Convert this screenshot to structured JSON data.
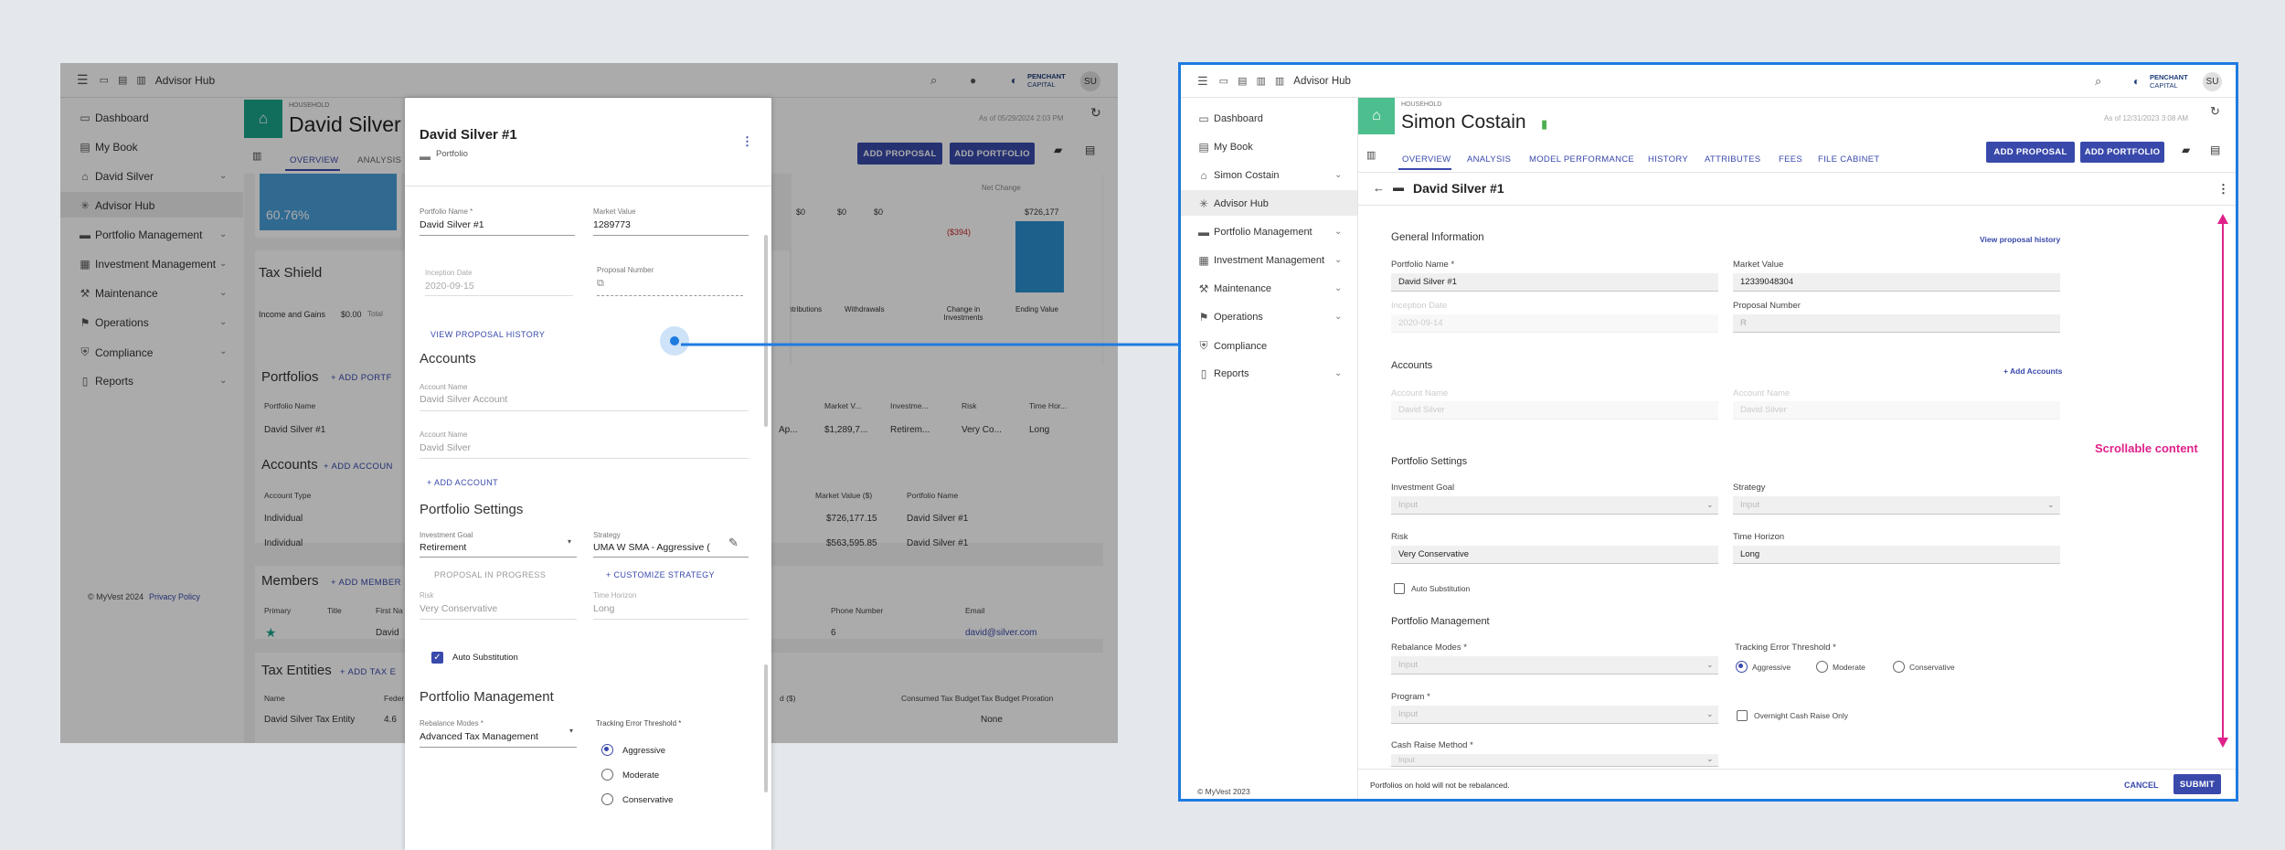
{
  "left": {
    "app_name": "Advisor Hub",
    "brand": {
      "name": "PENCHANT",
      "sub": "CAPITAL"
    },
    "avatar": "SU",
    "sidebar": [
      "Dashboard",
      "My Book",
      "David Silver",
      "Advisor Hub",
      "Portfolio Management",
      "Investment Management",
      "Maintenance",
      "Operations",
      "Compliance",
      "Reports"
    ],
    "footer": {
      "copyright": "© MyVest 2024",
      "privacy": "Privacy Policy"
    },
    "household": {
      "label": "HOUSEHOLD",
      "name": "David Silver",
      "as_of": "As of 05/29/2024 2:03 PM"
    },
    "tabs": [
      "OVERVIEW",
      "ANALYSIS"
    ],
    "buttons": {
      "add_proposal": "ADD PROPOSAL",
      "add_portfolio": "ADD PORTFOLIO"
    },
    "stat_pct": "60.76%",
    "chart": {
      "values": [
        "$0",
        "$0",
        "$0",
        "($394)",
        "$726,177"
      ],
      "xlabels": [
        "Contributions",
        "Withdrawals",
        "Change in Investments",
        "Ending Value"
      ],
      "net_change": "Net Change",
      "partial": [
        "",
        "..."
      ]
    },
    "tax_shield": {
      "title": "Tax Shield",
      "income": "Income and Gains",
      "amount": "$0.00",
      "total": "Total"
    },
    "portfolios": {
      "title": "Portfolios",
      "add": "+ ADD PORTF",
      "head": [
        "Portfolio Name",
        "Market V...",
        "Investme...",
        "Risk",
        "Time Hor..."
      ],
      "row": [
        "David Silver #1",
        "Ap...",
        "$1,289,7...",
        "Retirem...",
        "Very Co...",
        "Long"
      ]
    },
    "accounts": {
      "title": "Accounts",
      "add": "+ ADD ACCOUN",
      "head": [
        "Account Type",
        "Market Value ($)",
        "Portfolio Name"
      ],
      "rows": [
        [
          "Individual",
          "$726,177.15",
          "David Silver #1"
        ],
        [
          "Individual",
          "$563,595.85",
          "David Silver #1"
        ]
      ]
    },
    "members": {
      "title": "Members",
      "add": "+ ADD MEMBER",
      "head": [
        "Primary",
        "Title",
        "First Na",
        "Phone Number",
        "Email"
      ],
      "row": [
        "David",
        "6",
        "david@silver.com"
      ]
    },
    "tax_entities": {
      "title": "Tax Entities",
      "add": "+ ADD TAX E",
      "head": [
        "Name",
        "Feder",
        "d ($)",
        "Consumed Tax Budget",
        "Tax Budget Proration"
      ],
      "row": [
        "David Silver Tax Entity",
        "4.6",
        "None"
      ]
    }
  },
  "panel": {
    "title": "David Silver #1",
    "subtitle": "Portfolio",
    "portfolio_name_label": "Portfolio Name *",
    "portfolio_name": "David Silver #1",
    "market_value_label": "Market Value",
    "market_value": "1289773",
    "inception_label": "Inception Date",
    "inception": "2020-09-15",
    "proposal_label": "Proposal Number",
    "view_history": "VIEW PROPOSAL HISTORY",
    "accounts_title": "Accounts",
    "acct1_label": "Account Name",
    "acct1": "David Silver Account",
    "acct2_label": "Account Name",
    "acct2": "David Silver",
    "add_account": "+ ADD ACCOUNT",
    "settings_title": "Portfolio Settings",
    "goal_label": "Investment Goal",
    "goal": "Retirement",
    "strategy_label": "Strategy",
    "strategy": "UMA W SMA - Aggressive (",
    "in_progress": "PROPOSAL IN PROGRESS",
    "customize": "+ CUSTOMIZE STRATEGY",
    "risk_label": "Risk",
    "risk": "Very Conservative",
    "horizon_label": "Time Horizon",
    "horizon": "Long",
    "auto_sub": "Auto Substitution",
    "mgmt_title": "Portfolio Management",
    "rebalance_label": "Rebalance Modes *",
    "rebalance": "Advanced Tax Management",
    "tracking_label": "Tracking Error Threshold *",
    "tracking_options": [
      "Aggressive",
      "Moderate",
      "Conservative"
    ]
  },
  "right": {
    "app_name": "Advisor Hub",
    "brand": {
      "name": "PENCHANT",
      "sub": "CAPITAL"
    },
    "avatar": "SU",
    "sidebar": [
      "Dashboard",
      "My Book",
      "Simon Costain",
      "Advisor Hub",
      "Portfolio Management",
      "Investment Management",
      "Maintenance",
      "Operations",
      "Compliance",
      "Reports"
    ],
    "footer": "© MyVest 2023",
    "household": {
      "label": "HOUSEHOLD",
      "name": "Simon Costain",
      "as_of": "As of 12/31/2023 3:08 AM"
    },
    "tabs": [
      "OVERVIEW",
      "ANALYSIS",
      "MODEL PERFORMANCE",
      "HISTORY",
      "ATTRIBUTES",
      "FEES",
      "FILE CABINET"
    ],
    "buttons": {
      "add_proposal": "ADD PROPOSAL",
      "add_portfolio": "ADD PORTFOLIO"
    },
    "portfolio_title": "David Silver #1",
    "general_info": "General Information",
    "view_history": "View proposal history",
    "portfolio_name_label": "Portfolio Name *",
    "portfolio_name": "David Silver #1",
    "market_value_label": "Market Value",
    "market_value": "12339048304",
    "inception_label": "Inception Date",
    "inception": "2020-09-14",
    "proposal_label": "Proposal Number",
    "proposal": "R",
    "accounts_title": "Accounts",
    "add_accounts": "+ Add Accounts",
    "acct_label1": "Account Name",
    "acct1": "David Silver",
    "acct_label2": "Account Name",
    "acct2": "David Silver",
    "settings_title": "Portfolio Settings",
    "goal_label": "Investment Goal",
    "goal_ph": "Input",
    "strategy_label": "Strategy",
    "strategy_ph": "Input",
    "risk_label": "Risk",
    "risk": "Very Conservative",
    "horizon_label": "Time Horizon",
    "horizon": "Long",
    "auto_sub": "Auto Substitution",
    "mgmt_title": "Portfolio Management",
    "rebalance_label": "Rebalance Modes *",
    "rebalance_ph": "Input",
    "tracking_label": "Tracking Error Threshold *",
    "tracking_options": [
      "Aggressive",
      "Moderate",
      "Conservative"
    ],
    "program_label": "Program *",
    "program_ph": "Input",
    "overnight": "Overnight Cash Raise Only",
    "cash_raise_label": "Cash Raise Method *",
    "cash_raise_ph": "Input",
    "hold_note": "Portfolios on hold will not be rebalanced.",
    "cancel": "CANCEL",
    "submit": "SUBMIT",
    "scroll_note": "Scrollable content"
  },
  "colors": {
    "accent": "#3949ab",
    "green": "#4caf50",
    "highlight": "#1e7be0",
    "magenta": "#e0218a"
  }
}
